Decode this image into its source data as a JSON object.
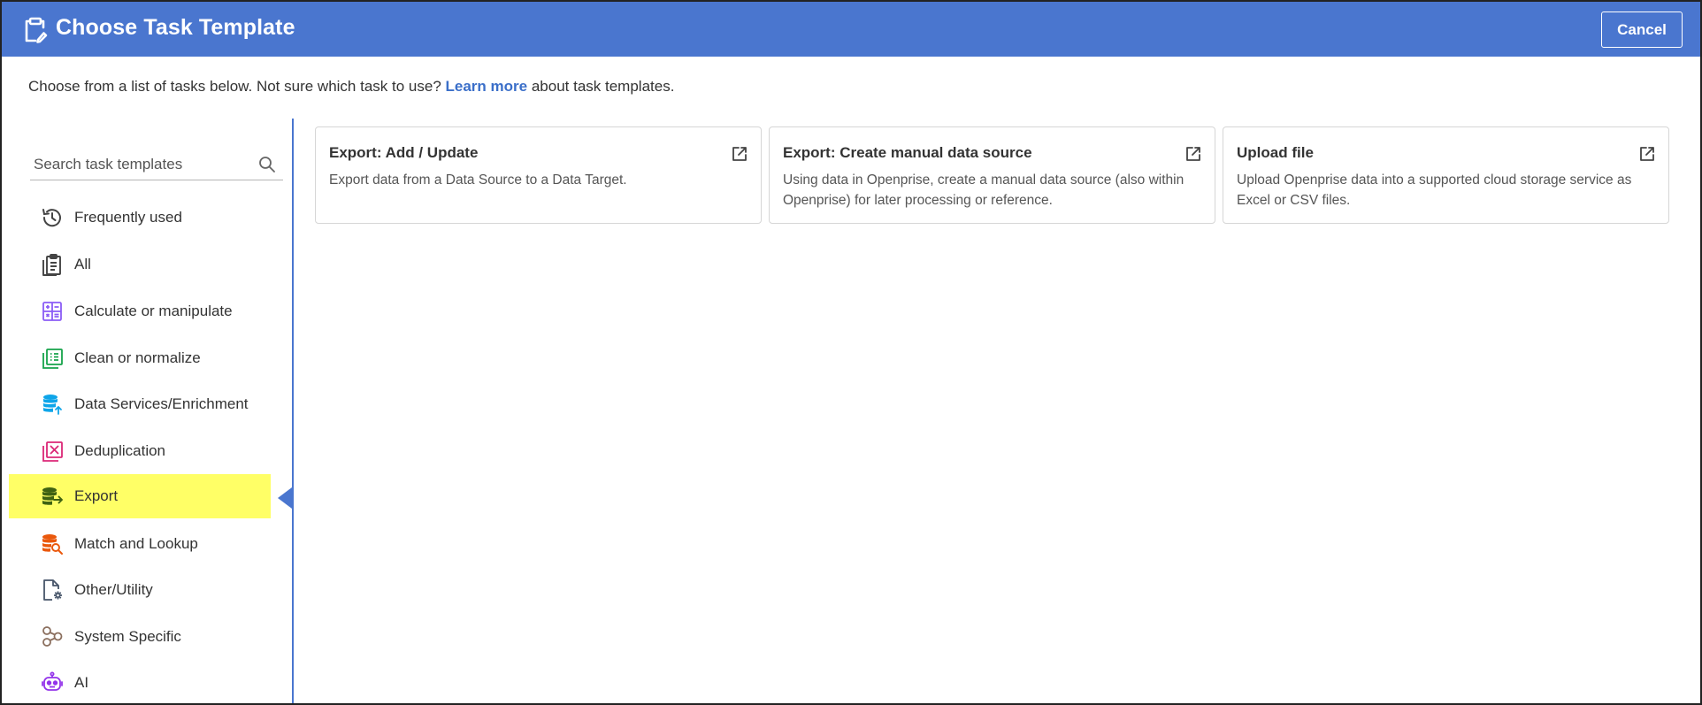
{
  "header": {
    "title": "Choose Task Template",
    "cancel_label": "Cancel"
  },
  "intro": {
    "prefix": "Choose from a list of tasks below. Not sure which task to use?",
    "link": "Learn more",
    "suffix": "about task templates."
  },
  "search": {
    "placeholder": "Search task templates",
    "value": ""
  },
  "sidebar": {
    "items": [
      {
        "label": "Frequently used",
        "icon": "history-icon"
      },
      {
        "label": "All",
        "icon": "clipboard-list-icon"
      },
      {
        "label": "Calculate or manipulate",
        "icon": "calculator-icon"
      },
      {
        "label": "Clean or normalize",
        "icon": "table-clean-icon"
      },
      {
        "label": "Data Services/Enrichment",
        "icon": "database-upload-icon"
      },
      {
        "label": "Deduplication",
        "icon": "duplicate-remove-icon"
      },
      {
        "label": "Export",
        "icon": "database-export-icon"
      },
      {
        "label": "Match and Lookup",
        "icon": "database-search-icon"
      },
      {
        "label": "Other/Utility",
        "icon": "file-settings-icon"
      },
      {
        "label": "System Specific",
        "icon": "system-nodes-icon"
      },
      {
        "label": "AI",
        "icon": "robot-icon"
      }
    ],
    "active": "Export"
  },
  "cards": [
    {
      "title": "Export: Add / Update",
      "description": "Export data from a Data Source to a Data Target."
    },
    {
      "title": "Export: Create manual data source",
      "description": "Using data in Openprise, create a manual data source (also within Openprise) for later processing or reference."
    },
    {
      "title": "Upload file",
      "description": "Upload Openprise data into a supported cloud storage service as Excel or CSV files."
    }
  ],
  "colors": {
    "header_bg": "#4a76cf",
    "active_highlight": "#ffff66",
    "link": "#3b6fc9"
  }
}
